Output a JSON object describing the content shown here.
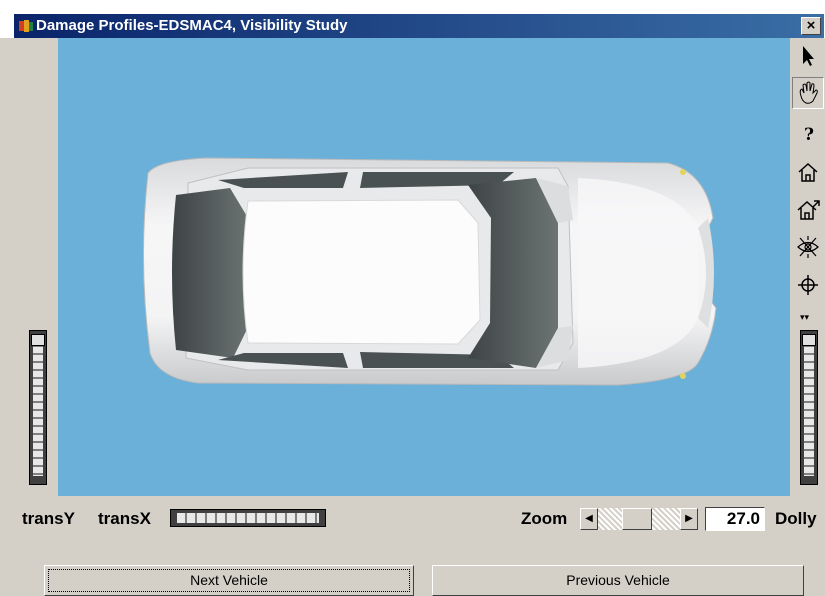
{
  "window": {
    "title": "Damage Profiles-EDSMAC4, Visibility Study",
    "close_label": "×"
  },
  "toolbar": {
    "tools": [
      "pointer-icon",
      "hand-icon",
      "help-icon",
      "home-icon",
      "set-home-icon",
      "view-all-icon",
      "seek-icon"
    ]
  },
  "controls": {
    "transY_label": "transY",
    "transX_label": "transX",
    "zoom_label": "Zoom",
    "zoom_value": "27.0",
    "dolly_label": "Dolly"
  },
  "buttons": {
    "next": "Next Vehicle",
    "previous": "Previous Vehicle"
  }
}
